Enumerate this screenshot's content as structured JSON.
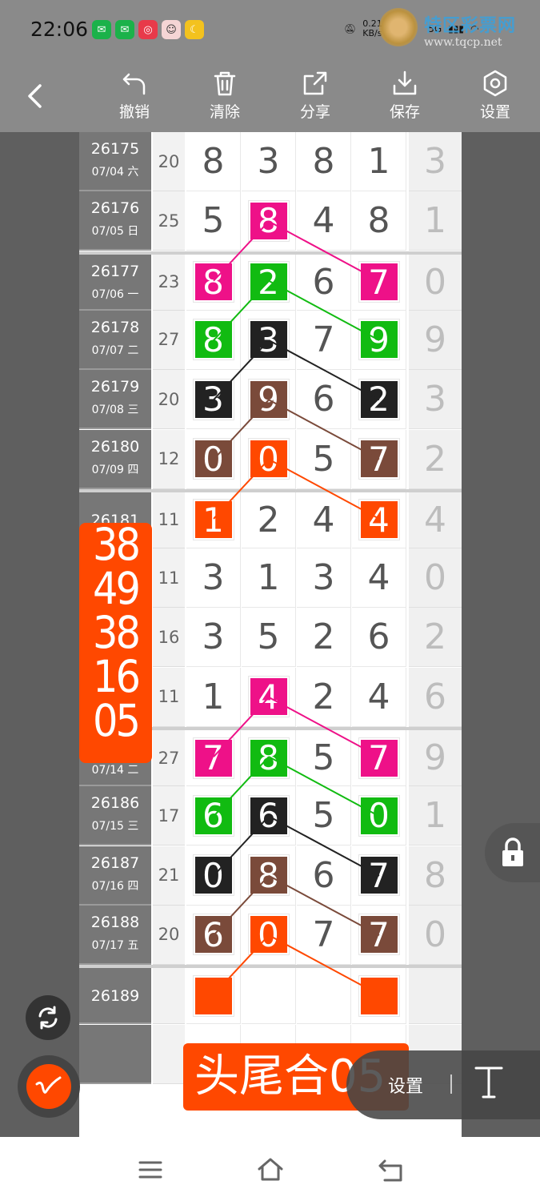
{
  "status_bar": {
    "time": "22:06",
    "net_speed": "0.21 KB/s",
    "signal_label": "5G",
    "apps": [
      "wechat-icon",
      "wechat-icon",
      "video-app-icon",
      "avatar-app-icon",
      "moon-app-icon"
    ]
  },
  "watermark": {
    "name": "特区彩票网",
    "url": "www.tqcp.net"
  },
  "toolbar": {
    "undo": "撤销",
    "clear": "清除",
    "share": "分享",
    "save": "保存",
    "settings": "设置"
  },
  "rows": [
    {
      "issue": "26175",
      "date": "07/04 六",
      "sum": "20",
      "digits": [
        "8",
        "3",
        "8",
        "1"
      ],
      "tail": "3",
      "marks": [
        null,
        null,
        null,
        null
      ]
    },
    {
      "issue": "26176",
      "date": "07/05 日",
      "sum": "25",
      "digits": [
        "5",
        "8",
        "4",
        "8"
      ],
      "tail": "1",
      "marks": [
        null,
        "#ee1188",
        null,
        null
      ]
    },
    {
      "issue": "26177",
      "date": "07/06 一",
      "sum": "23",
      "digits": [
        "8",
        "2",
        "6",
        "7"
      ],
      "tail": "0",
      "marks": [
        "#ee1188",
        "#11bb11",
        null,
        "#ee1188"
      ]
    },
    {
      "issue": "26178",
      "date": "07/07 二",
      "sum": "27",
      "digits": [
        "8",
        "3",
        "7",
        "9"
      ],
      "tail": "9",
      "marks": [
        "#11bb11",
        "#222222",
        null,
        "#11bb11"
      ]
    },
    {
      "issue": "26179",
      "date": "07/08 三",
      "sum": "20",
      "digits": [
        "3",
        "9",
        "6",
        "2"
      ],
      "tail": "3",
      "marks": [
        "#222222",
        "#7a4a3a",
        null,
        "#222222"
      ]
    },
    {
      "issue": "26180",
      "date": "07/09 四",
      "sum": "12",
      "digits": [
        "0",
        "0",
        "5",
        "7"
      ],
      "tail": "2",
      "marks": [
        "#7a4a3a",
        "#ff4800",
        null,
        "#7a4a3a"
      ]
    },
    {
      "issue": "26181",
      "date": "",
      "sum": "11",
      "digits": [
        "1",
        "2",
        "4",
        "4"
      ],
      "tail": "4",
      "marks": [
        "#ff4800",
        null,
        null,
        "#ff4800"
      ]
    },
    {
      "issue": "",
      "date": "",
      "sum": "11",
      "digits": [
        "3",
        "1",
        "3",
        "4"
      ],
      "tail": "0",
      "marks": [
        null,
        null,
        null,
        null
      ]
    },
    {
      "issue": "",
      "date": "",
      "sum": "16",
      "digits": [
        "3",
        "5",
        "2",
        "6"
      ],
      "tail": "2",
      "marks": [
        null,
        null,
        null,
        null
      ]
    },
    {
      "issue": "",
      "date": "",
      "sum": "11",
      "digits": [
        "1",
        "4",
        "2",
        "4"
      ],
      "tail": "6",
      "marks": [
        null,
        "#ee1188",
        null,
        null
      ]
    },
    {
      "issue": "",
      "date": "07/14 二",
      "sum": "27",
      "digits": [
        "7",
        "8",
        "5",
        "7"
      ],
      "tail": "9",
      "marks": [
        "#ee1188",
        "#11bb11",
        null,
        "#ee1188"
      ]
    },
    {
      "issue": "26186",
      "date": "07/15 三",
      "sum": "17",
      "digits": [
        "6",
        "6",
        "5",
        "0"
      ],
      "tail": "1",
      "marks": [
        "#11bb11",
        "#222222",
        null,
        "#11bb11"
      ]
    },
    {
      "issue": "26187",
      "date": "07/16 四",
      "sum": "21",
      "digits": [
        "0",
        "8",
        "6",
        "7"
      ],
      "tail": "8",
      "marks": [
        "#222222",
        "#7a4a3a",
        null,
        "#222222"
      ]
    },
    {
      "issue": "26188",
      "date": "07/17 五",
      "sum": "20",
      "digits": [
        "6",
        "0",
        "7",
        "7"
      ],
      "tail": "0",
      "marks": [
        "#7a4a3a",
        "#ff4800",
        null,
        "#7a4a3a"
      ]
    },
    {
      "issue": "26189",
      "date": "",
      "sum": "",
      "digits": [
        "",
        "",
        "",
        ""
      ],
      "tail": "",
      "marks": [
        "#ff4800",
        null,
        null,
        "#ff4800"
      ]
    },
    {
      "issue": "",
      "date": "",
      "sum": "",
      "digits": [
        "",
        "",
        "",
        ""
      ],
      "tail": "",
      "marks": [
        null,
        null,
        null,
        null
      ]
    }
  ],
  "dividers": [
    2,
    6,
    10,
    14
  ],
  "badge": {
    "lines": [
      "38",
      "49",
      "38",
      "16",
      "05"
    ]
  },
  "banner": {
    "text": "头尾合05"
  },
  "settings_pill": {
    "label": "设置"
  },
  "colors": {
    "accent": "#ff4800",
    "magenta": "#ee1188",
    "green": "#11bb11",
    "black": "#222222",
    "brown": "#7a4a3a"
  }
}
